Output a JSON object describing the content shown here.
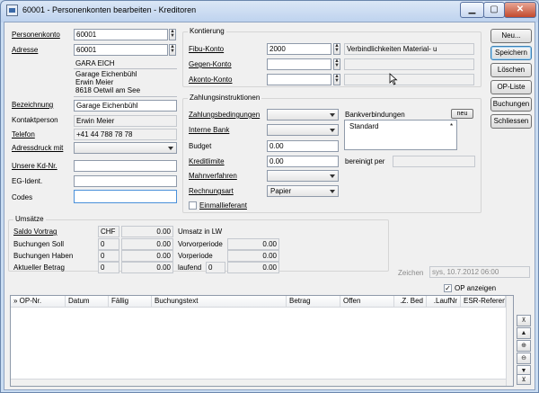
{
  "window": {
    "title": "60001 - Personenkonten bearbeiten - Kreditoren",
    "controls": {
      "minimize": "▁",
      "maximize": "▢",
      "close": "✕"
    }
  },
  "left": {
    "personenkonto_label": "Personenkonto",
    "personenkonto_value": "60001",
    "adresse_label": "Adresse",
    "adresse_value": "60001",
    "address_code": "GARA EICH",
    "address_lines": [
      "Garage Eichenbühl",
      "Erwin Meier",
      "8618 Oetwil am See"
    ],
    "bezeichnung_label": "Bezeichnung",
    "bezeichnung_value": "Garage Eichenbühl",
    "kontaktperson_label": "Kontaktperson",
    "kontaktperson_value": "Erwin Meier",
    "telefon_label": "Telefon",
    "telefon_value": "+41 44 788 78 78",
    "adressdruck_label": "Adressdruck mit",
    "unsere_label": "Unsere Kd-Nr.",
    "eg_label": "EG-Ident.",
    "codes_label": "Codes"
  },
  "kontierung": {
    "title": "Kontierung",
    "fibu_label": "Fibu-Konto",
    "fibu_value": "2000",
    "fibu_desc": "Verbindlichkeiten Material- u",
    "gegen_label": "Gegen-Konto",
    "akonto_label": "Akonto-Konto"
  },
  "zahlung": {
    "title": "Zahlungsinstruktionen",
    "bedingungen_label": "Zahlungsbedingungen",
    "interne_bank_label": "Interne Bank",
    "budget_label": "Budget",
    "budget_value": "0.00",
    "kreditlimite_label": "Kreditlimite",
    "kreditlimite_value": "0.00",
    "mahnverfahren_label": "Mahnverfahren",
    "rechnungsart_label": "Rechnungsart",
    "rechnungsart_value": "Papier",
    "einmal_label": "Einmallieferant",
    "bankverbindungen_label": "Bankverbindungen",
    "neu_label": "neu",
    "bank_items": [
      {
        "name": "Standard",
        "marker": "*"
      }
    ],
    "bereinigt_label": "bereinigt per"
  },
  "buttons": [
    "Neu...",
    "Speichern",
    "Löschen",
    "OP-Liste",
    "Buchungen",
    "Schliessen"
  ],
  "umsaetze": {
    "title": "Umsätze",
    "saldo_label": "Saldo Vortrag",
    "currency": "CHF",
    "saldo_value": "0.00",
    "soll_label": "Buchungen Soll",
    "soll_count": "0",
    "soll_value": "0.00",
    "haben_label": "Buchungen Haben",
    "haben_count": "0",
    "haben_value": "0.00",
    "aktuell_label": "Aktueller Betrag",
    "aktuell_count": "0",
    "aktuell_value": "0.00",
    "lw_label": "Umsatz in LW",
    "vorvorperiode_label": "Vorvorperiode",
    "vorvorperiode_value": "0.00",
    "vorperiode_label": "Vorperiode",
    "vorperiode_value": "0.00",
    "laufend_label": "laufend",
    "laufend_count": "0",
    "laufend_value": "0.00"
  },
  "zeichen": {
    "label": "Zeichen",
    "value": "sys,  10.7.2012  06:00"
  },
  "op_anzeigen": {
    "label": "OP anzeigen",
    "checked": "✓"
  },
  "grid": {
    "columns": [
      "» OP-Nr.",
      "Datum",
      "Fällig",
      "Buchungstext",
      "Betrag",
      "Offen",
      ".Z. Bed",
      ".LaufNr",
      "ESR-Referenz"
    ]
  },
  "nav": [
    "⊼",
    "▲",
    "⊕",
    "⊖",
    "▼",
    "⊻"
  ]
}
